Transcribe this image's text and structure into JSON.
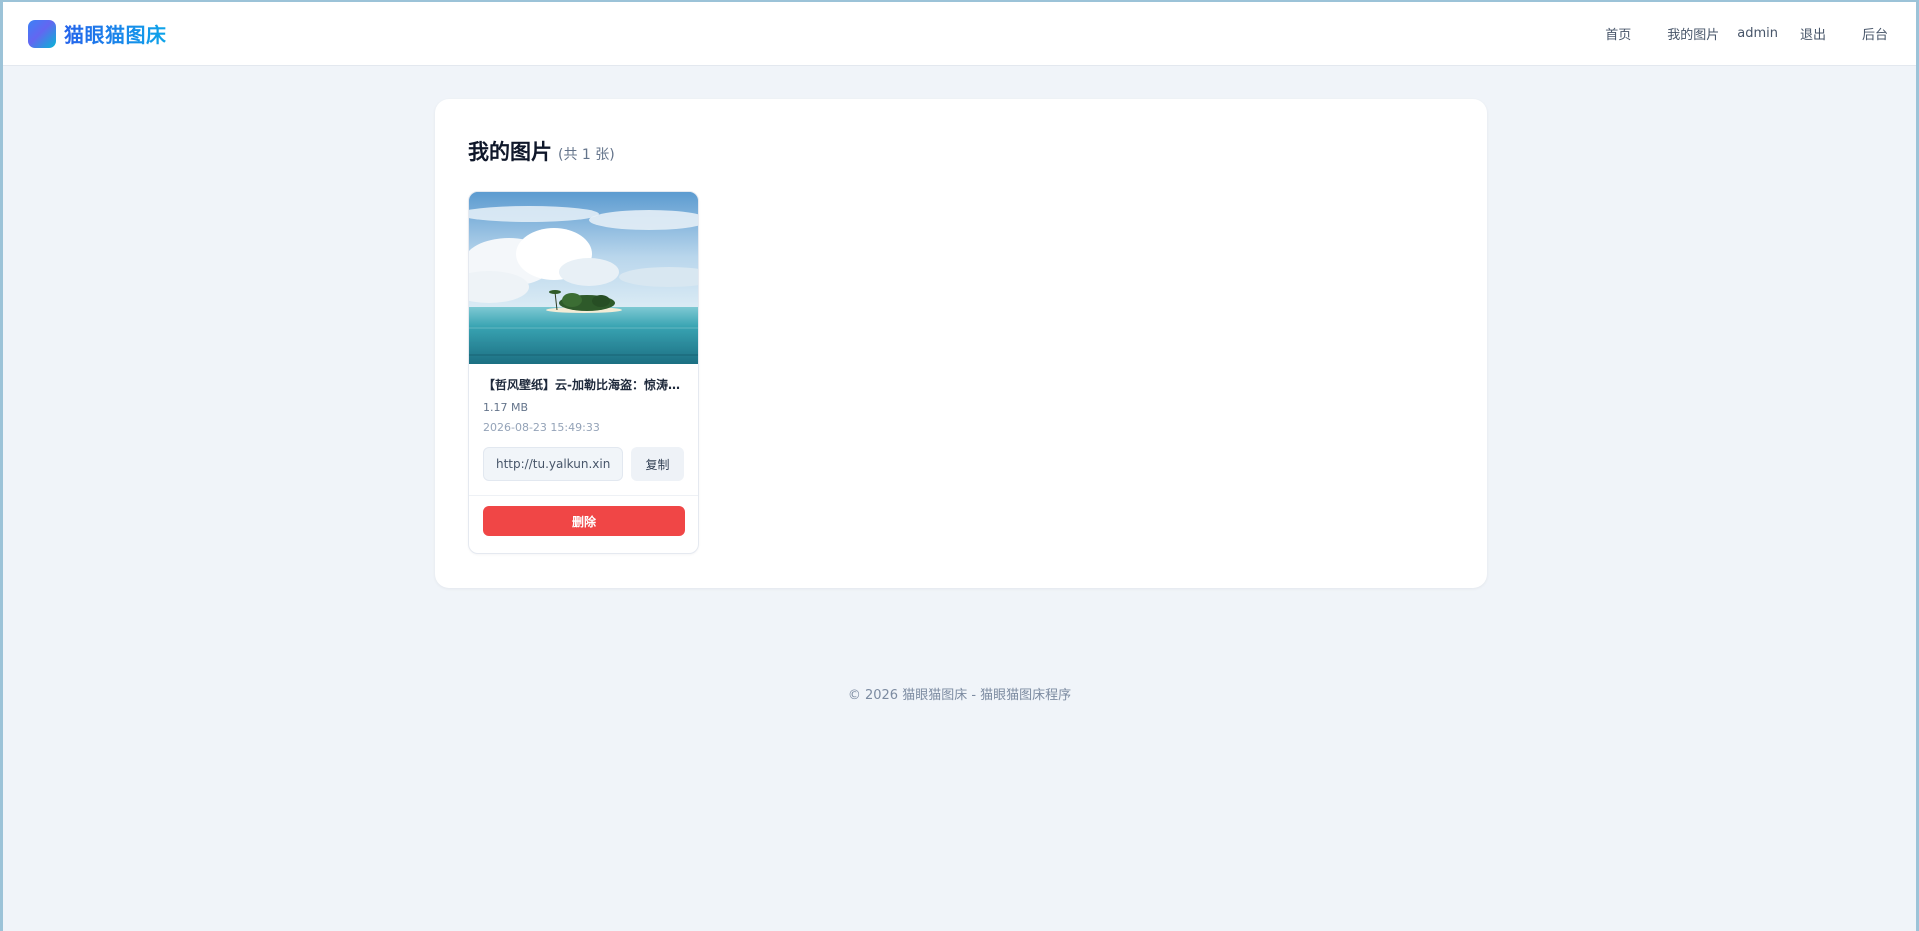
{
  "brand": {
    "name": "猫眼猫图床"
  },
  "nav": {
    "home": "首页",
    "my_images": "我的图片",
    "user": "admin",
    "logout": "退出",
    "admin": "后台"
  },
  "main": {
    "title": "我的图片",
    "count_text": "(共 1 张)",
    "images": [
      {
        "title": "【哲风壁纸】云-加勒比海盗：惊涛怪浪",
        "size": "1.17 MB",
        "date": "2026-08-23 15:49:33",
        "url": "http://tu.yalkun.xin/u",
        "copy_label": "复制",
        "delete_label": "删除"
      }
    ]
  },
  "footer": {
    "text": "© 2026 猫眼猫图床 - 猫眼猫图床程序"
  },
  "colors": {
    "accent": "#2563eb",
    "danger": "#f04646",
    "background": "#f0f4f9"
  }
}
